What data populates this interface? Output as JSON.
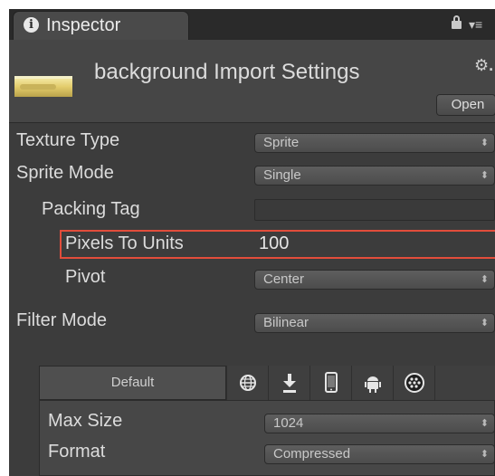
{
  "window": {
    "tab_title": "Inspector",
    "tab_info_glyph": "i",
    "tab_menu_glyph": "▾≡"
  },
  "header": {
    "title": "background Import Settings",
    "settings_glyph": "⚙.",
    "open_label": "Open"
  },
  "fields": {
    "texture_type": {
      "label": "Texture Type",
      "value": "Sprite"
    },
    "sprite_mode": {
      "label": "Sprite Mode",
      "value": "Single"
    },
    "packing_tag": {
      "label": "Packing Tag",
      "value": ""
    },
    "pixels_to_units": {
      "label": "Pixels To Units",
      "value": "100"
    },
    "pivot": {
      "label": "Pivot",
      "value": "Center"
    },
    "filter_mode": {
      "label": "Filter Mode",
      "value": "Bilinear"
    }
  },
  "platforms": {
    "default_label": "Default",
    "icons": [
      "globe-icon",
      "download-icon",
      "phone-icon",
      "android-icon",
      "blackberry-icon"
    ],
    "max_size": {
      "label": "Max Size",
      "value": "1024"
    },
    "format": {
      "label": "Format",
      "value": "Compressed"
    }
  },
  "colors": {
    "highlight": "#e24d3b",
    "panel_bg": "#3c3c3c"
  }
}
